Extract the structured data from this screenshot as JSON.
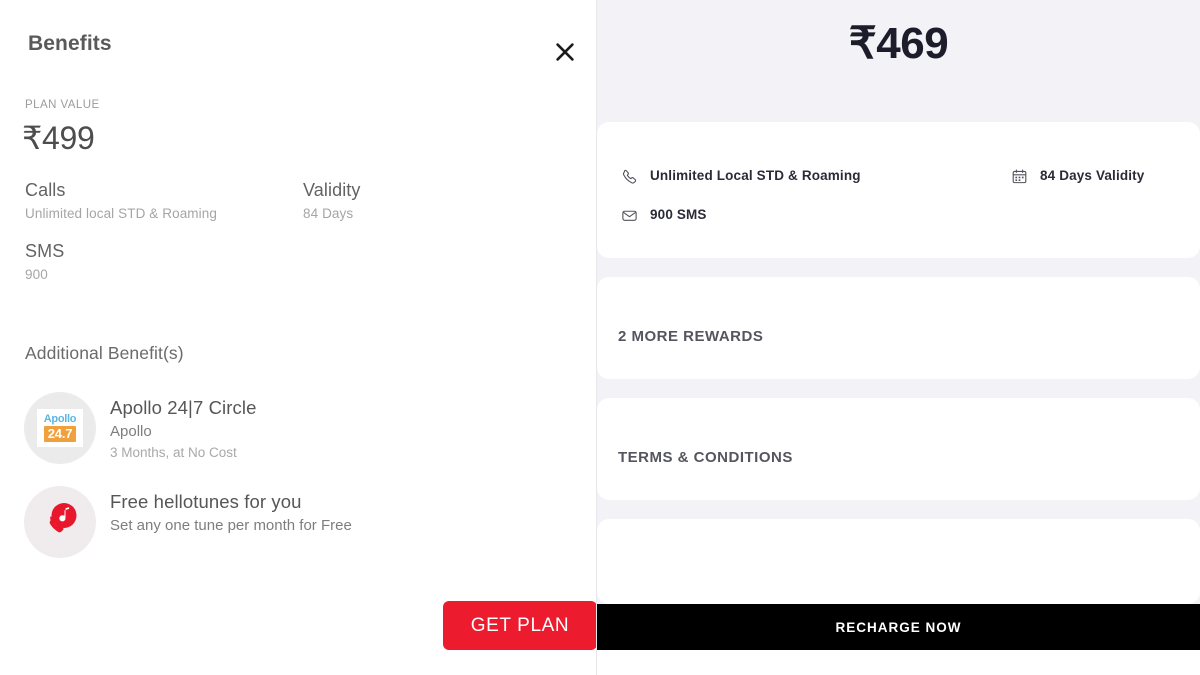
{
  "left_modal": {
    "title": "Benefits",
    "close_icon": "close-icon",
    "plan_value_label": "PLAN VALUE",
    "plan_value_amount": "₹499",
    "specs": [
      {
        "label": "Calls",
        "value": "Unlimited local STD & Roaming"
      },
      {
        "label": "Validity",
        "value": "84 Days"
      },
      {
        "label": "SMS",
        "value": "900"
      }
    ],
    "additional_heading": "Additional Benefit(s)",
    "additional_benefits": [
      {
        "icon": "apollo-24x7-logo-icon",
        "logo_word": "Apollo",
        "logo_number": "24.7",
        "title": "Apollo 24|7 Circle",
        "sub1": "Apollo",
        "sub2": "3 Months, at No Cost"
      },
      {
        "icon": "hellotunes-music-phone-icon",
        "title": "Free hellotunes for you",
        "sub1": "Set any one tune per month for Free",
        "sub2": ""
      }
    ],
    "cta_label": "GET PLAN",
    "cta_color": "#ED1B2E"
  },
  "right_screen": {
    "price": "₹469",
    "benefit_chips": [
      {
        "icon": "phone-handset-icon",
        "label": "Unlimited Local STD & Roaming"
      },
      {
        "icon": "calendar-icon",
        "label": "84 Days Validity"
      },
      {
        "icon": "envelope-icon",
        "label": "900 SMS"
      }
    ],
    "sections": [
      {
        "title": "2 MORE REWARDS"
      },
      {
        "title": "TERMS & CONDITIONS"
      }
    ],
    "cta_label": "RECHARGE NOW",
    "cta_color": "#000000",
    "background_color": "#F3F2F7"
  }
}
